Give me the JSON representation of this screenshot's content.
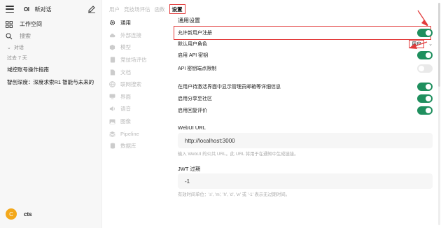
{
  "sidebar": {
    "logo": "OI",
    "new_chat": "新对话",
    "workspace": "工作空间",
    "search_placeholder": "搜索",
    "section_label": "对话",
    "period": "过去 7 天",
    "chats": [
      "域控账号操作指南",
      "智创深度：深度求索R1 智能与未来的"
    ],
    "user": {
      "initial": "C",
      "name": "cts"
    }
  },
  "tabs": [
    "用户",
    "竞技场评估",
    "函数",
    "设置"
  ],
  "active_tab": "设置",
  "settings_nav": [
    {
      "label": "通用",
      "icon": "gear-icon",
      "active": true
    },
    {
      "label": "外部连接",
      "icon": "cloud-icon",
      "active": false
    },
    {
      "label": "模型",
      "icon": "cube-icon",
      "active": false
    },
    {
      "label": "竞技场评估",
      "icon": "document-icon",
      "active": false
    },
    {
      "label": "文档",
      "icon": "file-icon",
      "active": false
    },
    {
      "label": "联网搜索",
      "icon": "globe-icon",
      "active": false
    },
    {
      "label": "界面",
      "icon": "monitor-icon",
      "active": false
    },
    {
      "label": "语音",
      "icon": "speaker-icon",
      "active": false
    },
    {
      "label": "图像",
      "icon": "image-icon",
      "active": false
    },
    {
      "label": "Pipeline",
      "icon": "layers-icon",
      "active": false
    },
    {
      "label": "数据库",
      "icon": "database-icon",
      "active": false
    }
  ],
  "content": {
    "title": "通用设置",
    "rows": [
      {
        "label": "允许新用户注册",
        "type": "toggle",
        "on": true
      },
      {
        "label": "默认用户角色",
        "type": "select",
        "value": "用户"
      },
      {
        "label": "启用 API 密钥",
        "type": "toggle",
        "on": true
      },
      {
        "label": "API 密钥端点限制",
        "type": "toggle",
        "on": false
      },
      {
        "label": "在用户待激活界面中显示管理员邮箱等详细信息",
        "type": "toggle",
        "on": true
      },
      {
        "label": "启用分享至社区",
        "type": "toggle",
        "on": true
      },
      {
        "label": "启用回复评价",
        "type": "toggle",
        "on": true
      }
    ],
    "webui_url": {
      "label": "WebUI URL",
      "value": "http://localhost:3000",
      "hint": "输入 WebUI 的公共 URL。此 URL 将用于在通知中生成链接。"
    },
    "jwt": {
      "label": "JWT 过期",
      "value": "-1",
      "hint": "有效时间单位：'s', 'm', 'h', 'd', 'w' 或 '-1' 表示无过期时间。"
    }
  },
  "colors": {
    "accent": "#1f8f5e",
    "highlight": "#e23b3b",
    "avatar": "#f3a81b"
  }
}
